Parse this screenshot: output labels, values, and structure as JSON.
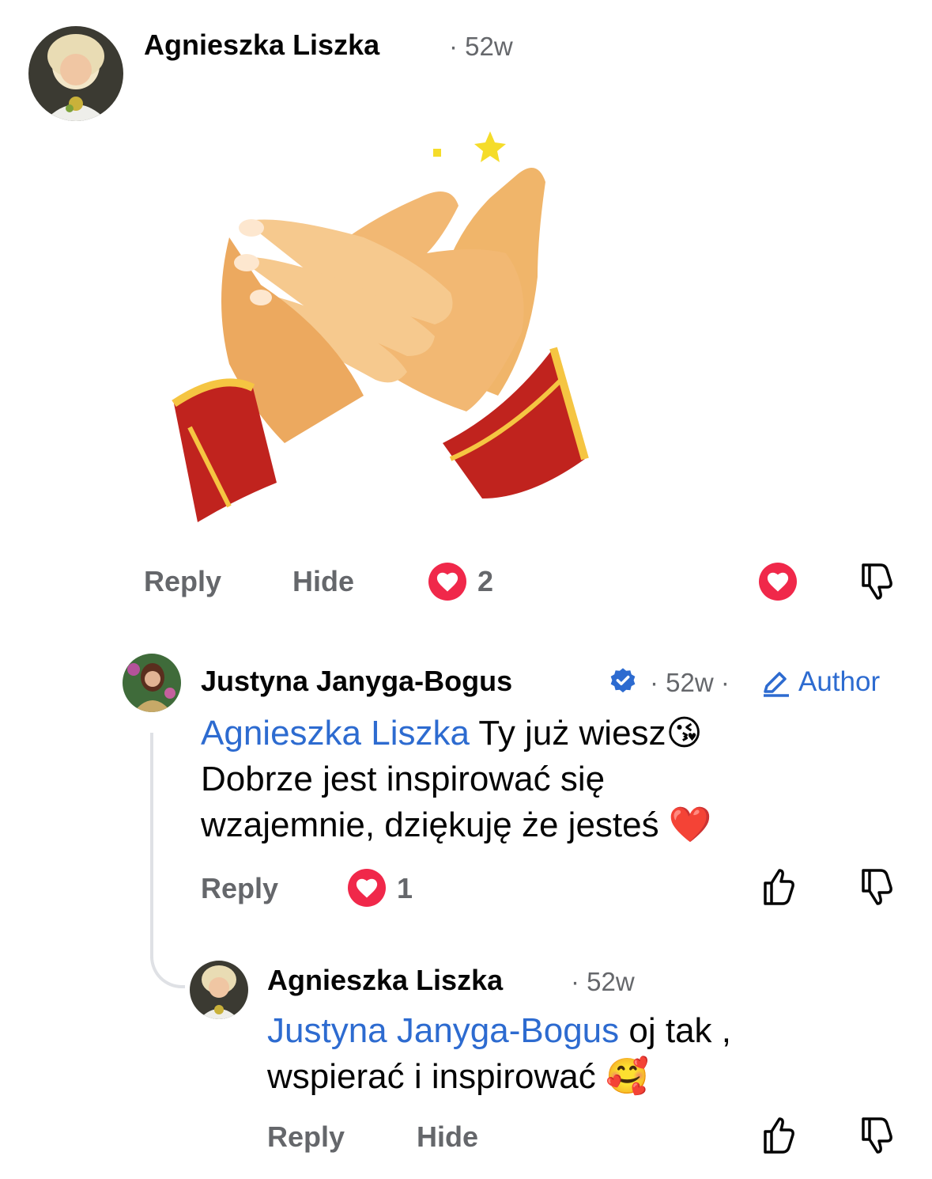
{
  "comments": [
    {
      "author": "Agnieszka Liszka",
      "time": "· 52w",
      "sticker": "clapping-hands-sticker",
      "actions": {
        "reply": "Reply",
        "hide": "Hide"
      },
      "reaction_count": "2"
    },
    {
      "author": "Justyna Janyga-Bogus",
      "time": "· 52w ·",
      "badge": "Author",
      "mention": "Agnieszka Liszka",
      "text_line1": " Ty już wiesz",
      "text_line2": "Dobrze jest inspirować się",
      "text_line3": "wzajemnie, dziękuję że jesteś ",
      "emoji_kiss": "😘",
      "emoji_heart": "❤️",
      "actions": {
        "reply": "Reply"
      },
      "reaction_count": "1"
    },
    {
      "author": "Agnieszka Liszka",
      "time": "· 52w",
      "mention": "Justyna Janyga-Bogus",
      "text_line1": " oj tak ,",
      "text_line2": "wspierać i inspirować ",
      "emoji_smile": "🥰",
      "actions": {
        "reply": "Reply",
        "hide": "Hide"
      }
    }
  ],
  "colors": {
    "accent": "#2d6bd0",
    "heart": "#f0284a",
    "muted": "#65676b"
  },
  "icons": [
    "heart-reaction-icon",
    "thumbs-up-icon",
    "thumbs-down-icon",
    "verified-badge-icon",
    "pencil-icon"
  ]
}
